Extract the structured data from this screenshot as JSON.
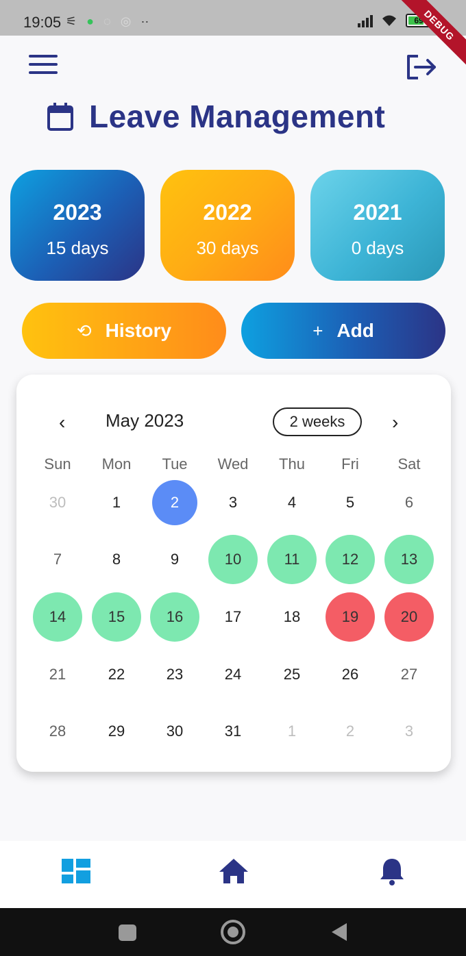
{
  "status_bar": {
    "time": "19:05",
    "battery_level": "69",
    "debug_label": "DEBUG"
  },
  "header": {
    "title": "Leave Management"
  },
  "year_cards": [
    {
      "year": "2023",
      "days": "15 days"
    },
    {
      "year": "2022",
      "days": "30 days"
    },
    {
      "year": "2021",
      "days": "0 days"
    }
  ],
  "actions": {
    "history_label": "History",
    "add_label": "Add"
  },
  "calendar": {
    "month_label": "May 2023",
    "format_label": "2 weeks",
    "weekdays": [
      "Sun",
      "Mon",
      "Tue",
      "Wed",
      "Thu",
      "Fri",
      "Sat"
    ],
    "weeks": [
      [
        {
          "d": "30",
          "s": "muted"
        },
        {
          "d": "1",
          "s": ""
        },
        {
          "d": "2",
          "s": "today"
        },
        {
          "d": "3",
          "s": ""
        },
        {
          "d": "4",
          "s": ""
        },
        {
          "d": "5",
          "s": ""
        },
        {
          "d": "6",
          "s": "weekend"
        }
      ],
      [
        {
          "d": "7",
          "s": "weekend"
        },
        {
          "d": "8",
          "s": ""
        },
        {
          "d": "9",
          "s": ""
        },
        {
          "d": "10",
          "s": "leave"
        },
        {
          "d": "11",
          "s": "leave"
        },
        {
          "d": "12",
          "s": "leave"
        },
        {
          "d": "13",
          "s": "leave"
        }
      ],
      [
        {
          "d": "14",
          "s": "leave"
        },
        {
          "d": "15",
          "s": "leave"
        },
        {
          "d": "16",
          "s": "leave"
        },
        {
          "d": "17",
          "s": ""
        },
        {
          "d": "18",
          "s": ""
        },
        {
          "d": "19",
          "s": "holiday"
        },
        {
          "d": "20",
          "s": "holiday"
        }
      ],
      [
        {
          "d": "21",
          "s": "weekend"
        },
        {
          "d": "22",
          "s": ""
        },
        {
          "d": "23",
          "s": ""
        },
        {
          "d": "24",
          "s": ""
        },
        {
          "d": "25",
          "s": ""
        },
        {
          "d": "26",
          "s": ""
        },
        {
          "d": "27",
          "s": "weekend"
        }
      ],
      [
        {
          "d": "28",
          "s": "weekend"
        },
        {
          "d": "29",
          "s": ""
        },
        {
          "d": "30",
          "s": ""
        },
        {
          "d": "31",
          "s": ""
        },
        {
          "d": "1",
          "s": "muted"
        },
        {
          "d": "2",
          "s": "muted"
        },
        {
          "d": "3",
          "s": "muted"
        }
      ]
    ]
  },
  "bottom_nav": {
    "items": [
      {
        "icon": "dashboard-icon",
        "active": true
      },
      {
        "icon": "home-icon",
        "active": false
      },
      {
        "icon": "bell-icon",
        "active": false
      }
    ]
  },
  "colors": {
    "brand_navy": "#2b3486",
    "accent_blue": "#129fe0",
    "orange": "#ff9a16",
    "today": "#5b8cf6",
    "leave_green": "#7de8b0",
    "holiday_red": "#f45d65"
  }
}
